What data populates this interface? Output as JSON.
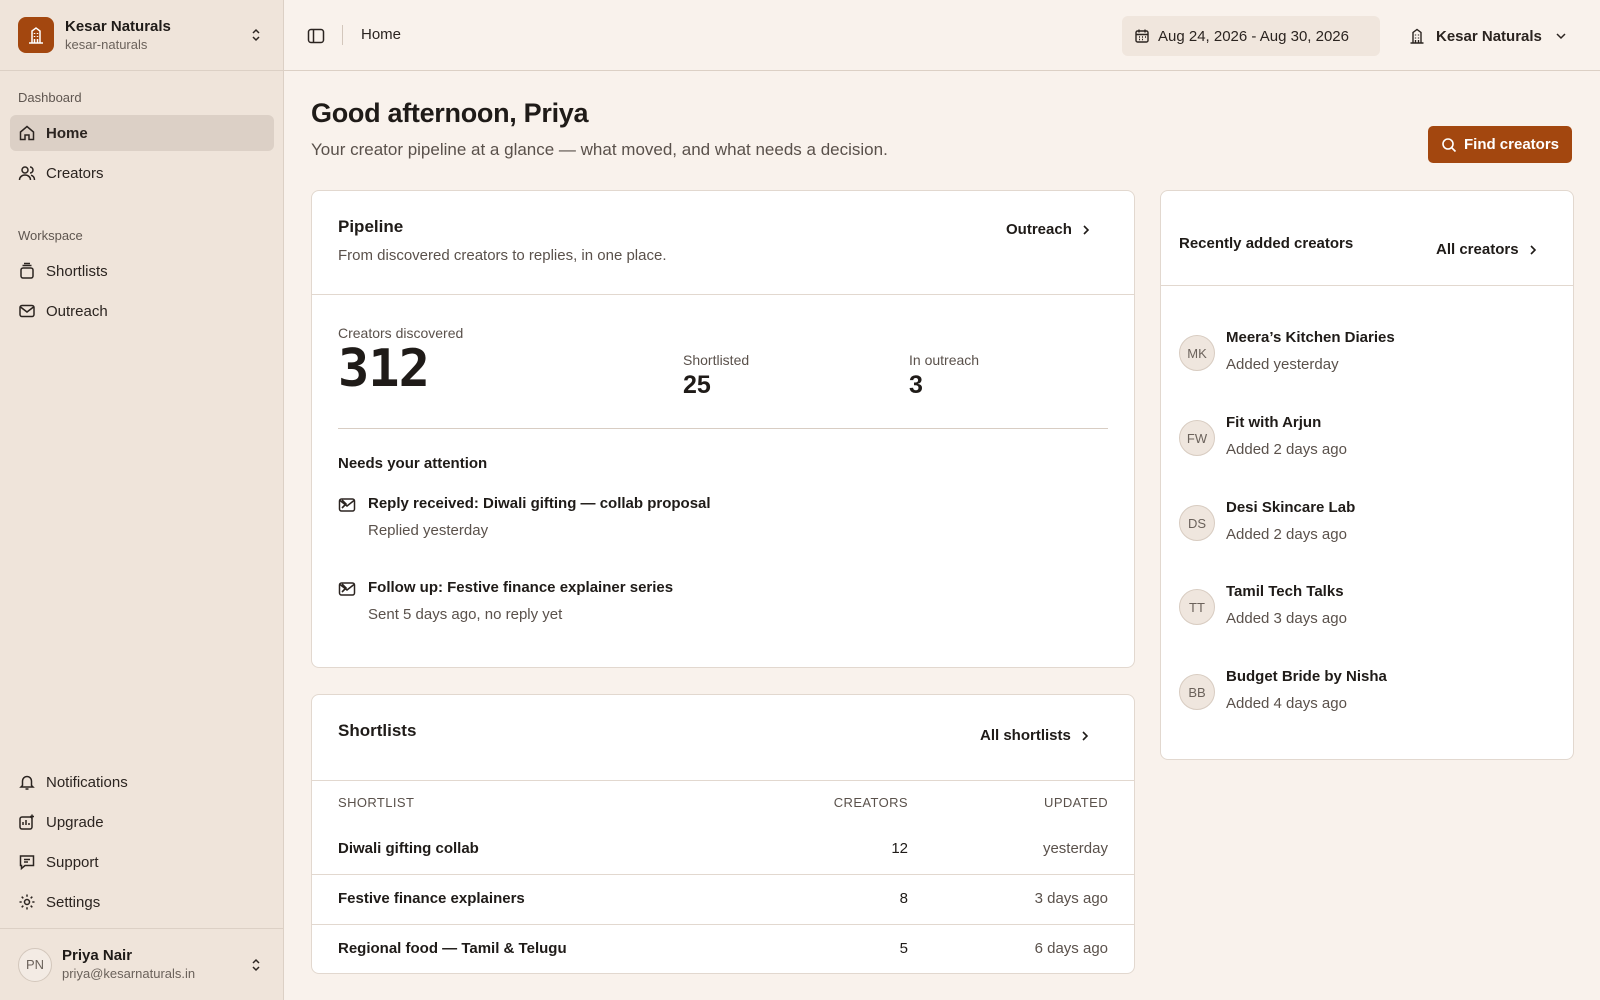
{
  "org": {
    "name": "Kesar Naturals",
    "slug": "kesar-naturals",
    "accent": "#a3470f"
  },
  "sidebar": {
    "sections": [
      {
        "label": "Dashboard",
        "items": [
          {
            "label": "Home",
            "icon": "home-icon",
            "active": true
          },
          {
            "label": "Creators",
            "icon": "users-icon",
            "active": false
          }
        ]
      },
      {
        "label": "Workspace",
        "items": [
          {
            "label": "Shortlists",
            "icon": "stack-icon",
            "active": false
          },
          {
            "label": "Outreach",
            "icon": "mail-icon",
            "active": false
          }
        ]
      }
    ],
    "bottom_items": [
      {
        "label": "Notifications",
        "icon": "bell-icon"
      },
      {
        "label": "Upgrade",
        "icon": "sparkle-icon"
      },
      {
        "label": "Support",
        "icon": "chat-icon"
      },
      {
        "label": "Settings",
        "icon": "gear-icon"
      }
    ]
  },
  "user": {
    "initials": "PN",
    "name": "Priya Nair",
    "email": "priya@kesarnaturals.in"
  },
  "topbar": {
    "breadcrumb": "Home",
    "date_range": "Aug 24, 2026 - Aug 30, 2026",
    "brand_selector": "Kesar Naturals"
  },
  "main": {
    "greeting": "Good afternoon, Priya",
    "subtitle": "Your creator pipeline at a glance — what moved, and what needs a decision.",
    "find_button": "Find creators"
  },
  "pipeline": {
    "title": "Pipeline",
    "description": "From discovered creators to replies, in one place.",
    "link": "Outreach",
    "stats": {
      "discovered_label": "Creators discovered",
      "discovered_value": "312",
      "shortlisted_label": "Shortlisted",
      "shortlisted_value": "25",
      "outreach_label": "In outreach",
      "outreach_value": "3"
    },
    "attention_title": "Needs your attention",
    "attention": [
      {
        "title": "Reply received: Diwali gifting — collab proposal",
        "sub": "Replied yesterday"
      },
      {
        "title": "Follow up: Festive finance explainer series",
        "sub": "Sent 5 days ago, no reply yet"
      }
    ]
  },
  "shortlists": {
    "title": "Shortlists",
    "link": "All shortlists",
    "columns": [
      "SHORTLIST",
      "CREATORS",
      "UPDATED"
    ],
    "rows": [
      {
        "name": "Diwali gifting collab",
        "creators": "12",
        "updated": "yesterday"
      },
      {
        "name": "Festive finance explainers",
        "creators": "8",
        "updated": "3 days ago"
      },
      {
        "name": "Regional food — Tamil & Telugu",
        "creators": "5",
        "updated": "6 days ago"
      }
    ]
  },
  "recent": {
    "title": "Recently added creators",
    "link": "All creators",
    "items": [
      {
        "initials": "MK",
        "name": "Meera’s Kitchen Diaries",
        "added": "Added yesterday"
      },
      {
        "initials": "FW",
        "name": "Fit with Arjun",
        "added": "Added 2 days ago"
      },
      {
        "initials": "DS",
        "name": "Desi Skincare Lab",
        "added": "Added 2 days ago"
      },
      {
        "initials": "TT",
        "name": "Tamil Tech Talks",
        "added": "Added 3 days ago"
      },
      {
        "initials": "BB",
        "name": "Budget Bride by Nisha",
        "added": "Added 4 days ago"
      }
    ]
  }
}
